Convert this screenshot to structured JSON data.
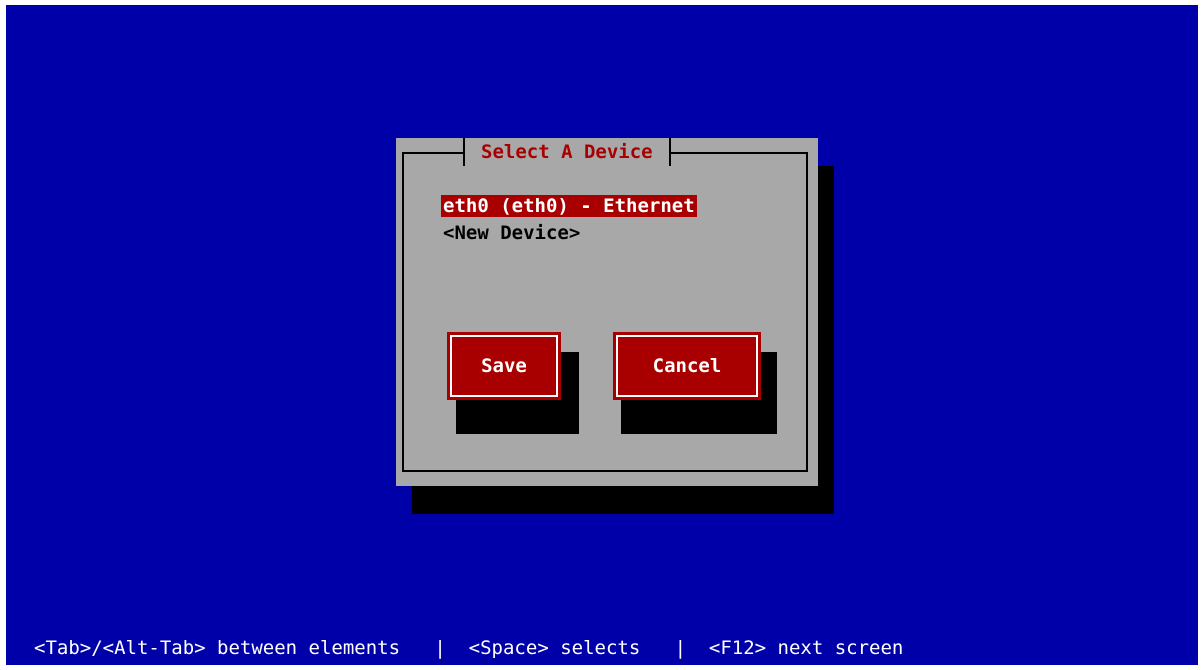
{
  "dialog": {
    "title": "Select A Device",
    "items": [
      {
        "label": "eth0 (eth0) - Ethernet",
        "selected": true
      },
      {
        "label": "<New Device>",
        "selected": false
      }
    ]
  },
  "buttons": {
    "save_label": "Save",
    "cancel_label": "Cancel"
  },
  "status_bar": {
    "text": "<Tab>/<Alt-Tab> between elements   |  <Space> selects   |  <F12> next screen"
  },
  "colors": {
    "background": "#0000a8",
    "dialog": "#a8a8a8",
    "accent": "#a80000",
    "text_light": "#ffffff",
    "shadow": "#000000"
  }
}
